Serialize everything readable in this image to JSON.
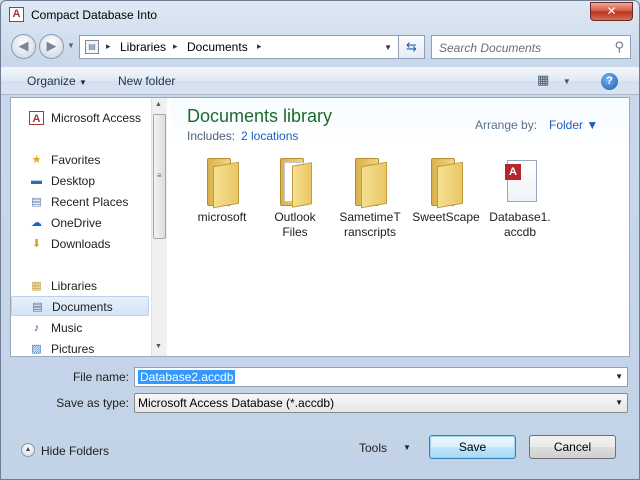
{
  "window": {
    "title": "Compact Database Into",
    "app_icon": "A",
    "close_glyph": "✕"
  },
  "navigation": {
    "back_glyph": "◀",
    "forward_glyph": "▶",
    "breadcrumbs": [
      "Libraries",
      "Documents"
    ],
    "crumb_separator": "▸",
    "search_placeholder": "Search Documents",
    "search_icon": "search-icon"
  },
  "toolbar": {
    "organize_label": "Organize",
    "new_folder_label": "New folder",
    "help_glyph": "?"
  },
  "nav_pane": {
    "items": [
      {
        "label": "Microsoft Access",
        "icon": "access-icon",
        "glyph": "A"
      },
      {
        "label": "Favorites",
        "icon": "star-icon",
        "glyph": "★"
      },
      {
        "label": "Desktop",
        "icon": "desktop-icon",
        "glyph": "▬"
      },
      {
        "label": "Recent Places",
        "icon": "recent-places-icon",
        "glyph": "▤"
      },
      {
        "label": "OneDrive",
        "icon": "cloud-icon",
        "glyph": "☁"
      },
      {
        "label": "Downloads",
        "icon": "downloads-icon",
        "glyph": "⬇"
      },
      {
        "label": "Libraries",
        "icon": "libraries-icon",
        "glyph": "▦"
      },
      {
        "label": "Documents",
        "icon": "documents-icon",
        "glyph": "▤"
      },
      {
        "label": "Music",
        "icon": "music-icon",
        "glyph": "♪"
      },
      {
        "label": "Pictures",
        "icon": "pictures-icon",
        "glyph": "▨"
      }
    ],
    "selected": "Documents"
  },
  "library": {
    "title": "Documents library",
    "includes_label": "Includes:",
    "includes_link": "2 locations",
    "arrange_label": "Arrange by:",
    "arrange_value": "Folder ▼"
  },
  "files": [
    {
      "line1": "microsoft",
      "line2": "",
      "type": "folder"
    },
    {
      "line1": "Outlook",
      "line2": "Files",
      "type": "folder"
    },
    {
      "line1": "SametimeT",
      "line2": "ranscripts",
      "type": "folder"
    },
    {
      "line1": "SweetScape",
      "line2": "",
      "type": "folder"
    },
    {
      "line1": "Database1.",
      "line2": "accdb",
      "type": "accdb"
    }
  ],
  "form": {
    "file_name_label": "File name:",
    "file_name_value": "Database2.accdb",
    "save_type_label": "Save as type:",
    "save_type_value": "Microsoft Access Database (*.accdb)"
  },
  "footer": {
    "hide_folders_label": "Hide Folders",
    "tools_label": "Tools",
    "save_label": "Save",
    "cancel_label": "Cancel"
  },
  "colors": {
    "library_title": "#1e6a2d",
    "link": "#1e5fbf",
    "selection": "#3399ff",
    "close_button": "#c7442f"
  }
}
